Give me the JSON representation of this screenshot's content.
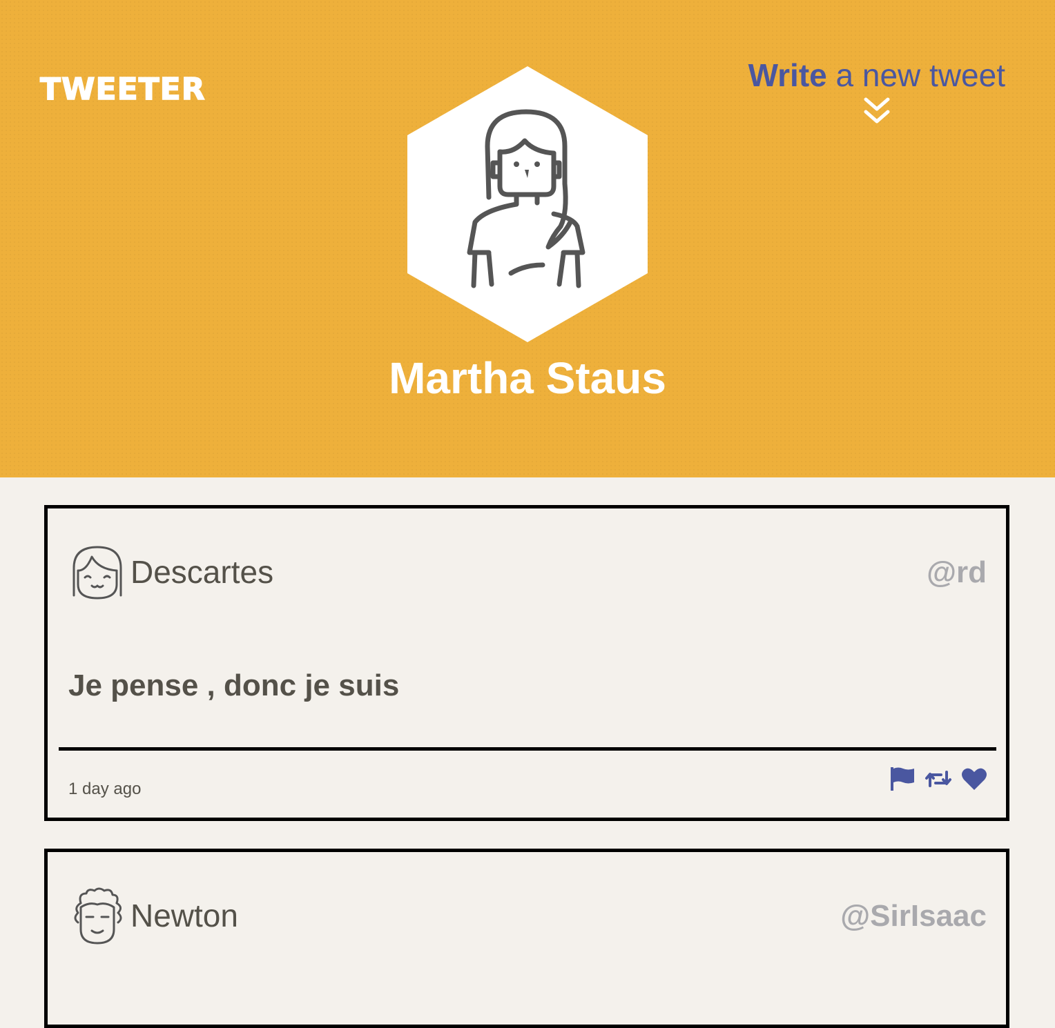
{
  "brand": {
    "name": "TWEETER"
  },
  "compose": {
    "strong": "Write",
    "rest": "a new tweet"
  },
  "profile": {
    "name": "Martha Staus"
  },
  "tweets": [
    {
      "author": "Descartes",
      "handle": "@rd",
      "text": "Je pense , donc je suis",
      "time": "1 day ago"
    },
    {
      "author": "Newton",
      "handle": "@SirIsaac"
    }
  ],
  "colors": {
    "header": "#eeb03b",
    "accent": "#4a57a0",
    "background": "#f4f1ec",
    "text": "#545149",
    "handle": "#a9a9ad"
  }
}
